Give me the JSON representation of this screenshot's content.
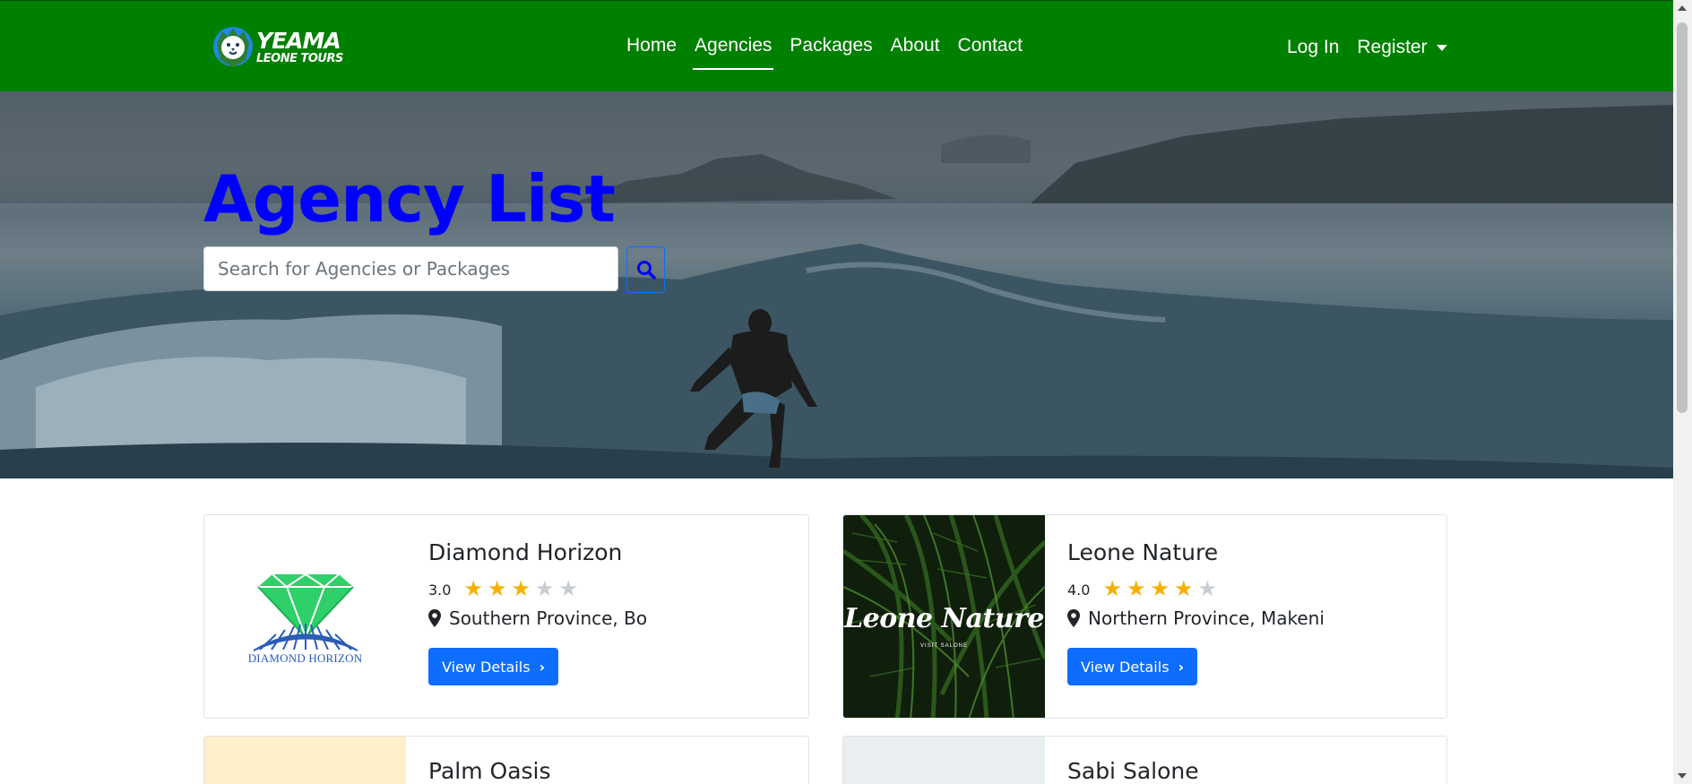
{
  "brand": {
    "line1": "YEAMA",
    "line2": "LEONE TOURS"
  },
  "nav": {
    "links": [
      {
        "label": "Home"
      },
      {
        "label": "Agencies"
      },
      {
        "label": "Packages"
      },
      {
        "label": "About"
      },
      {
        "label": "Contact"
      }
    ],
    "login": "Log In",
    "register": "Register"
  },
  "hero": {
    "title": "Agency List",
    "search_placeholder": "Search for Agencies or Packages"
  },
  "agencies": [
    {
      "name": "Diamond Horizon",
      "rating": "3.0",
      "stars": 3,
      "location": "Southern Province, Bo",
      "button": "View Details",
      "logo_text": "DIAMOND HORIZON"
    },
    {
      "name": "Leone Nature",
      "rating": "4.0",
      "stars": 4,
      "location": "Northern Province, Makeni",
      "button": "View Details",
      "logo_text": "Leone Nature",
      "logo_sub": "VISIT SALONE"
    },
    {
      "name": "Palm Oasis"
    },
    {
      "name": "Sabi Salone"
    }
  ],
  "colors": {
    "navbar": "#008000",
    "hero_title": "#0000ff",
    "primary_button": "#0d6efd",
    "star_on": "#f5b000",
    "star_off": "#c9cdd2"
  }
}
